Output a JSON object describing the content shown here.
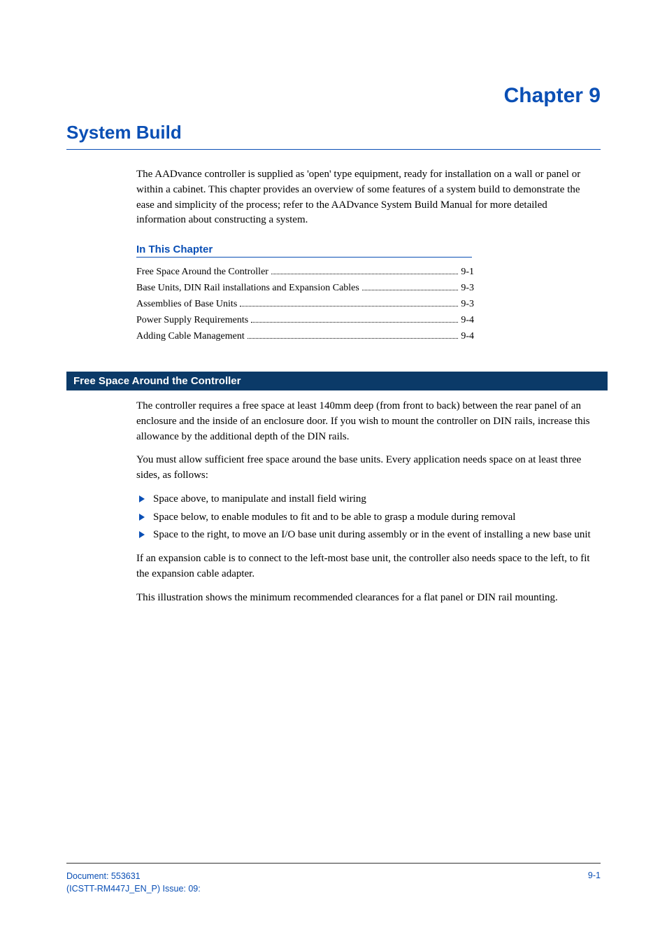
{
  "chapter_label": "Chapter 9",
  "chapter_title": "System Build",
  "intro": "The AADvance controller is supplied as 'open' type equipment, ready for installation on a wall or panel or within a cabinet. This chapter provides an overview of some features of a system build to demonstrate the ease and simplicity of the process; refer to the AADvance System Build Manual for more detailed information about constructing a system.",
  "toc_heading": "In This Chapter",
  "toc": [
    {
      "label": "Free Space Around the Controller",
      "page": "9-1"
    },
    {
      "label": "Base Units, DIN Rail installations and Expansion Cables",
      "page": "9-3"
    },
    {
      "label": "Assemblies of Base Units",
      "page": "9-3"
    },
    {
      "label": "Power Supply Requirements",
      "page": "9-4"
    },
    {
      "label": "Adding Cable Management",
      "page": "9-4"
    }
  ],
  "section_bar": "Free Space Around the Controller",
  "paras": {
    "p1": "The controller requires a free space at least 140mm deep (from front to back) between the rear panel of an enclosure and the inside of an enclosure door. If you wish to mount the controller on DIN rails, increase this allowance by the additional depth of the DIN rails.",
    "p2": "You must allow sufficient free space around the base units. Every application needs space on at least three sides, as follows:",
    "p3": "If an expansion cable is to connect to the left-most base unit, the controller also needs space to the left, to fit the expansion cable adapter.",
    "p4": "This illustration shows the minimum recommended clearances for a flat panel or DIN rail mounting."
  },
  "bullets": [
    "Space above, to manipulate and install field wiring",
    "Space below, to enable modules to fit and to be able to grasp a module during removal",
    "Space to the right, to move an I/O base unit during assembly or in the event of installing a new base unit"
  ],
  "footer": {
    "doc": "Document: 553631",
    "issue": "(ICSTT-RM447J_EN_P) Issue: 09:",
    "page": "9-1"
  }
}
